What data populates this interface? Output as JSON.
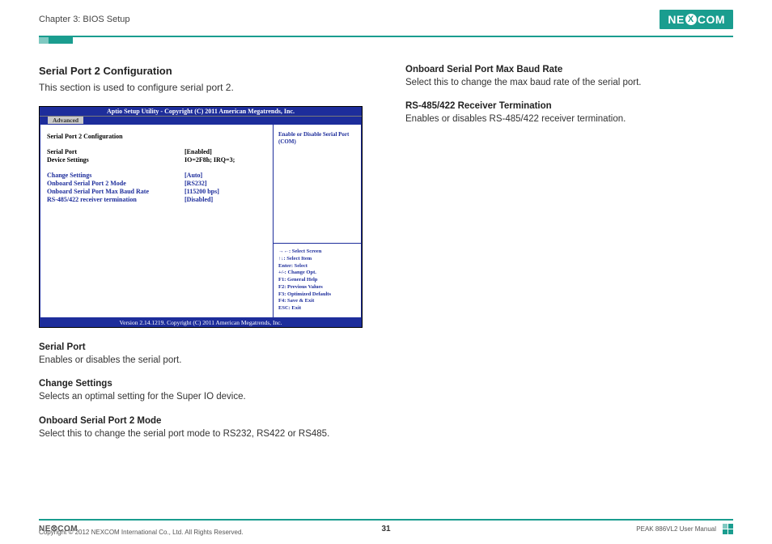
{
  "header": {
    "chapter": "Chapter 3: BIOS Setup",
    "logo_parts": {
      "pre": "NE",
      "x": "X",
      "post": "COM"
    }
  },
  "left_column": {
    "title": "Serial Port 2 Configuration",
    "intro": "This section is used to configure serial port 2.",
    "bios": {
      "title": "Aptio Setup Utility - Copyright (C) 2011 American Megatrends, Inc.",
      "tab": "Advanced",
      "group_title": "Serial Port 2 Configuration",
      "rows": [
        {
          "label": "Serial Port",
          "value": "[Enabled]",
          "style": "black"
        },
        {
          "label": "Device Settings",
          "value": "IO=2F8h; IRQ=3;",
          "style": "black"
        },
        {
          "label": "Change Settings",
          "value": "[Auto]",
          "style": "blue"
        },
        {
          "label": "Onboard Serial Port 2 Mode",
          "value": "[RS232]",
          "style": "blue"
        },
        {
          "label": "Onboard Serial Port Max Baud Rate",
          "value": "[115200 bps]",
          "style": "blue"
        },
        {
          "label": "RS-485/422 receiver termination",
          "value": "[Disabled]",
          "style": "blue"
        }
      ],
      "side_top": "Enable or Disable Serial Port (COM)",
      "side_help": [
        "→←: Select Screen",
        "↑↓: Select Item",
        "Enter: Select",
        "+/-: Change Opt.",
        "F1: General Help",
        "F2: Previous Values",
        "F3: Optimized Defaults",
        "F4: Save & Exit",
        "ESC: Exit"
      ],
      "footer": "Version 2.14.1219. Copyright (C) 2011 American Megatrends, Inc."
    },
    "subsections": [
      {
        "heading": "Serial Port",
        "text": "Enables or disables the serial port."
      },
      {
        "heading": "Change Settings",
        "text": "Selects an optimal setting for the Super IO device."
      },
      {
        "heading": "Onboard Serial Port 2 Mode",
        "text": "Select this to change the serial port mode to RS232, RS422 or RS485."
      }
    ]
  },
  "right_column": {
    "subsections": [
      {
        "heading": "Onboard Serial Port Max Baud Rate",
        "text": "Select this to change the max baud rate of the serial port."
      },
      {
        "heading": "RS-485/422 Receiver Termination",
        "text": "Enables or disables RS-485/422 receiver termination."
      }
    ]
  },
  "footer": {
    "logo_text": "NE⮾COM",
    "copyright": "Copyright © 2012 NEXCOM International Co., Ltd. All Rights Reserved.",
    "page_number": "31",
    "manual": "PEAK 886VL2 User Manual"
  }
}
